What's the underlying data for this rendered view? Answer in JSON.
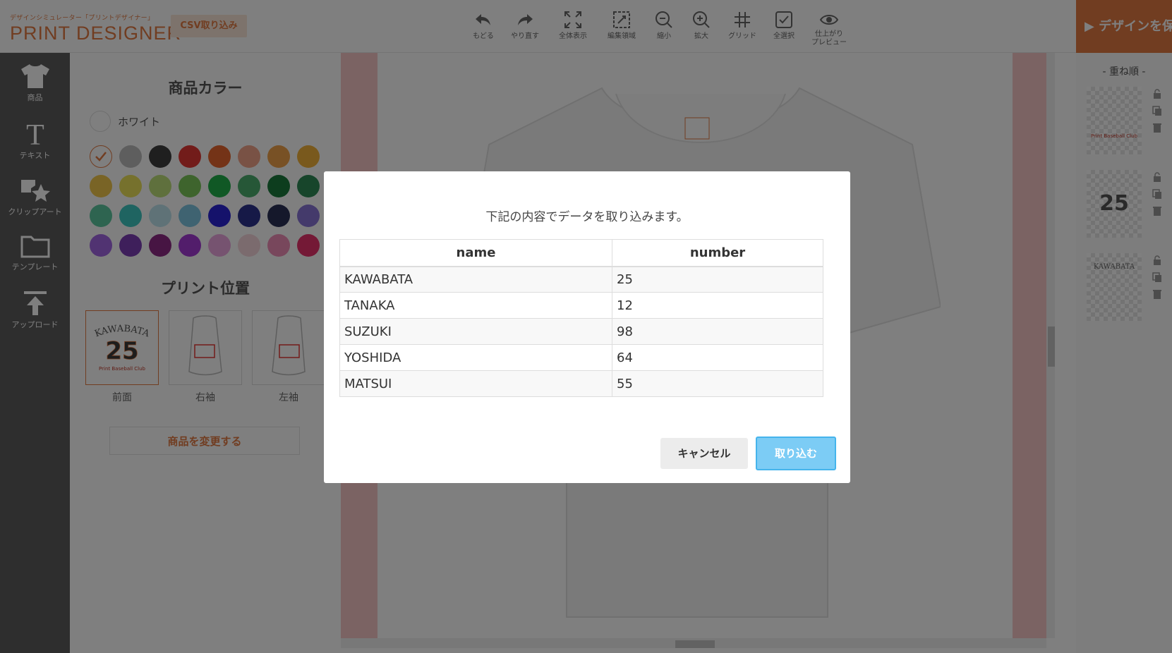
{
  "header": {
    "logo_sub": "デザインシミュレーター「プリントデザイナー」",
    "logo_main": "PRINT DESIGNER",
    "csv_button": "CSV取り込み",
    "tools": [
      {
        "label": "もどる",
        "icon": "undo-icon"
      },
      {
        "label": "やり直す",
        "icon": "redo-icon"
      },
      {
        "label": "全体表示",
        "icon": "fit-screen-icon"
      },
      {
        "label": "編集領域",
        "icon": "edit-area-icon"
      },
      {
        "label": "縮小",
        "icon": "zoom-out-icon"
      },
      {
        "label": "拡大",
        "icon": "zoom-in-icon"
      },
      {
        "label": "グリッド",
        "icon": "grid-icon"
      },
      {
        "label": "全選択",
        "icon": "select-all-icon"
      },
      {
        "label": "仕上がり",
        "label2": "プレビュー",
        "icon": "preview-eye-icon"
      }
    ],
    "finish_button": "▶ デザインを保"
  },
  "sidebar": {
    "items": [
      {
        "label": "商品",
        "icon": "tshirt-icon"
      },
      {
        "label": "テキスト",
        "icon": "text-icon"
      },
      {
        "label": "クリップアート",
        "icon": "clipart-icon"
      },
      {
        "label": "テンプレート",
        "icon": "folder-icon"
      },
      {
        "label": "アップロード",
        "icon": "upload-icon"
      }
    ]
  },
  "panel": {
    "color_title": "商品カラー",
    "selected_color": "ホワイト",
    "swatches": [
      "#ffffff",
      "#bdbdbd",
      "#3f3f3f",
      "#e53935",
      "#e8672e",
      "#f2a58a",
      "#f0a24a",
      "#f3b33a",
      "#f2c94c",
      "#ede25a",
      "#bfe07a",
      "#7cc95a",
      "#21b14b",
      "#4caf6e",
      "#1b7a3d",
      "#2e8b57",
      "#5cc9a0",
      "#3ec9c2",
      "#bfe4ef",
      "#7ec6e2",
      "#2a24d6",
      "#2d338f",
      "#2b3156",
      "#8874d6",
      "#a266e5",
      "#7d3fb6",
      "#8e2a86",
      "#a53ad6",
      "#eda7e0",
      "#f7d6dc",
      "#f08fb8",
      "#e8336d"
    ],
    "position_title": "プリント位置",
    "positions": [
      {
        "label": "前面",
        "name_text": "KAWABATA",
        "number_text": "25",
        "club_text": "Print Baseball Club"
      },
      {
        "label": "右袖"
      },
      {
        "label": "左袖"
      }
    ],
    "change_button": "商品を変更する"
  },
  "layers": {
    "title": "- 重ね順 -",
    "items": [
      {
        "preview": "Print Baseball Club"
      },
      {
        "preview": "25"
      },
      {
        "preview": "KAWABATA"
      }
    ]
  },
  "modal": {
    "message": "下記の内容でデータを取り込みます。",
    "columns": [
      "name",
      "number"
    ],
    "rows": [
      [
        "KAWABATA",
        "25"
      ],
      [
        "TANAKA",
        "12"
      ],
      [
        "SUZUKI",
        "98"
      ],
      [
        "YOSHIDA",
        "64"
      ],
      [
        "MATSUI",
        "55"
      ]
    ],
    "cancel_button": "キャンセル",
    "import_button": "取り込む"
  },
  "colors": {
    "accent": "#e27a43",
    "sidebar": "#5d5d5d",
    "import_button": "#7cccf5",
    "guide": "#f6c6c6"
  }
}
